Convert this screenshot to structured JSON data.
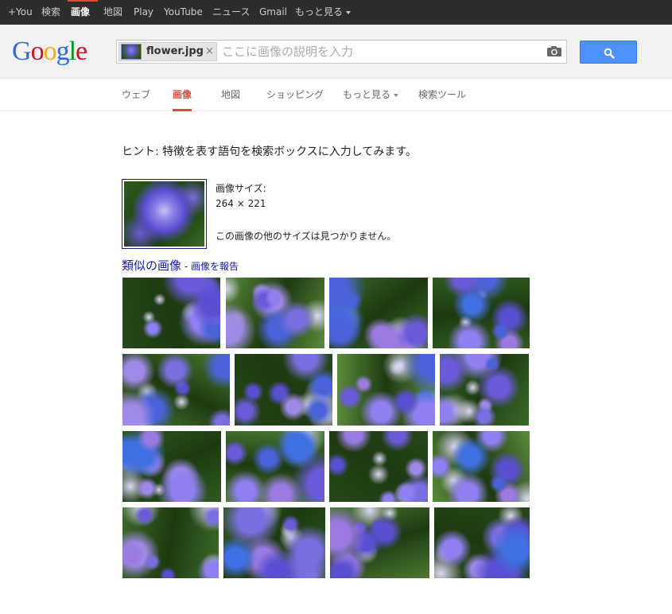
{
  "topbar": {
    "items": [
      {
        "label": "+You",
        "name": "topbar-you-link"
      },
      {
        "label": "検索",
        "name": "topbar-search-link"
      },
      {
        "label": "画像",
        "name": "topbar-images-link",
        "active": true
      },
      {
        "label": "地図",
        "name": "topbar-maps-link"
      },
      {
        "label": "Play",
        "name": "topbar-play-link"
      },
      {
        "label": "YouTube",
        "name": "topbar-youtube-link"
      },
      {
        "label": "ニュース",
        "name": "topbar-news-link"
      },
      {
        "label": "Gmail",
        "name": "topbar-gmail-link"
      },
      {
        "label": "もっと見る",
        "name": "topbar-more-link",
        "dropdown": true
      }
    ],
    "active_color": "#dd4b39"
  },
  "logo": {
    "letters": [
      {
        "ch": "G",
        "color": "#3369e8"
      },
      {
        "ch": "o",
        "color": "#d50f25"
      },
      {
        "ch": "o",
        "color": "#eeb211"
      },
      {
        "ch": "g",
        "color": "#3369e8"
      },
      {
        "ch": "l",
        "color": "#009925"
      },
      {
        "ch": "e",
        "color": "#d50f25"
      }
    ]
  },
  "search": {
    "chip_filename": "flower.jpg",
    "chip_remove": "×",
    "placeholder": "ここに画像の説明を入力",
    "camera_icon": "camera-icon",
    "button_icon": "search-icon",
    "button_color": "#4d90fe"
  },
  "tabs": [
    {
      "label": "ウェブ",
      "name": "tab-web"
    },
    {
      "label": "画像",
      "name": "tab-images",
      "active": true
    },
    {
      "label": "地図",
      "name": "tab-maps"
    },
    {
      "label": "ショッピング",
      "name": "tab-shopping"
    },
    {
      "label": "もっと見る",
      "name": "tab-more",
      "dropdown": true
    },
    {
      "label": "検索ツール",
      "name": "tab-search-tools"
    }
  ],
  "hint": "ヒント: 特徴を表す語句を検索ボックスに入力してみます。",
  "image_info": {
    "size_label": "画像サイズ:",
    "size_value": "264 × 221",
    "no_other_sizes": "この画像の他のサイズは見つかりません。"
  },
  "similar": {
    "title": "類似の画像",
    "separator": " - ",
    "report_link": "画像を報告"
  }
}
